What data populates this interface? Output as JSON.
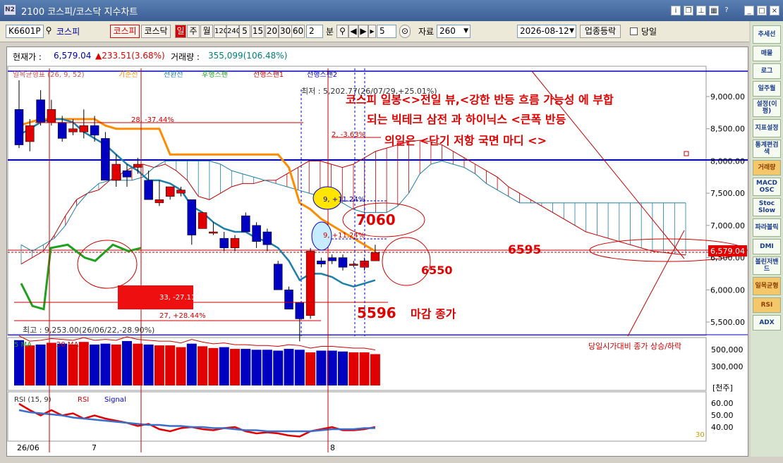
{
  "window": {
    "title": "2100 코스피/코스닥 지수차트",
    "logo": "N2"
  },
  "toolbar": {
    "code": "K6601P",
    "code_name": "코스피",
    "btn_kospi": "코스피",
    "btn_kosdaq": "코스닥",
    "periods": [
      "일",
      "주",
      "월",
      "120",
      "240",
      "5",
      "15",
      "20",
      "30",
      "60"
    ],
    "min_value": "2",
    "min_label": "분",
    "step_value": "5",
    "data_label": "자료",
    "data_value": "260",
    "date": "2026-08-12",
    "sector_btn": "업종등락",
    "today_label": "당일"
  },
  "info": {
    "price_label": "현재가 :",
    "price": "6,579.04",
    "change": "▲233.51(3.68%)",
    "volume_label": "거래량 :",
    "volume": "355,099(106.48%)"
  },
  "legend": {
    "ichimoku": "일목균형표 (26, 9, 52)",
    "items": [
      "기준선",
      "전환선",
      "후행스팬",
      "선행스팬1",
      "선행스팬2"
    ]
  },
  "annotations": {
    "line1": "코스피 일봉<>전일 뷰,<강한 반등 흐름  가능성 에 부합",
    "line2": "되는 빅테크 삼전 과 하이닉스 <큰폭 반등",
    "line3": "의일은 <단기 저항 국면 마디 <>",
    "high_label": "최저 : 5,202.77(26/07/29,+25.01%)",
    "low_label": "최고 : 9,253.00(26/06/22,-28.90%)",
    "m1": "28, -37.44%",
    "m2": "2, -3.63%",
    "m3": "9, +11.24%",
    "m4": "9, +11.24%",
    "m5": "33, -27.11%",
    "m6": "27, +28.44%",
    "v7060": "7060",
    "v6595": "6595",
    "v6550": "6550",
    "v5596": "5596",
    "closing": "마감 종가",
    "vol_note": "당일시가대비 종가 상승/하락"
  },
  "axis": {
    "price_ticks": [
      "9,000.00",
      "8,500.00",
      "8,000.00",
      "7,500.00",
      "7,000.00",
      "6,500.00",
      "6,000.00",
      "5,500.00"
    ],
    "current_tag": "6,579.04",
    "vol_ticks": [
      "500,000",
      "300,000"
    ],
    "vol_unit": "[천주]",
    "rsi_ticks": [
      "60.00",
      "50.00",
      "40.00"
    ],
    "rsi_level": "30",
    "x_labels": [
      "26/06",
      "7",
      "8"
    ]
  },
  "panels": {
    "vol_legend": [
      "5 MA",
      "20 MA"
    ],
    "rsi_legend": [
      "RSI (15, 9)",
      "RSI",
      "Signal"
    ]
  },
  "right_menu": [
    "추세선",
    "매물",
    "로그",
    "일주월",
    "설정(이평)",
    "지표설정",
    "통계편검색",
    "거래량",
    "MACD OSC",
    "Stoc Slow",
    "파라볼릭",
    "DMI",
    "볼린저밴드",
    "일목균형",
    "RSI",
    "ADX"
  ],
  "colors": {
    "up": "#e00000",
    "down": "#0000c0",
    "kijun": "#ff8c00",
    "tenkan": "#1e7fa8",
    "chikou": "#1fa01f",
    "span": "#c00000"
  },
  "chart_data": {
    "type": "candlestick",
    "candles": [
      [
        8800,
        9253,
        8200,
        8250
      ],
      [
        8300,
        8650,
        8150,
        8550
      ],
      [
        8950,
        9100,
        8550,
        8600
      ],
      [
        8600,
        8950,
        8550,
        8800
      ],
      [
        8600,
        8700,
        8300,
        8350
      ],
      [
        8450,
        8650,
        8400,
        8500
      ],
      [
        8450,
        8800,
        8350,
        8550
      ],
      [
        8550,
        8700,
        8300,
        8400
      ],
      [
        8350,
        8450,
        7800,
        7700
      ],
      [
        7700,
        8100,
        7600,
        7950
      ],
      [
        7850,
        7950,
        7600,
        7750
      ],
      [
        7900,
        8050,
        7800,
        7950
      ],
      [
        7700,
        7850,
        7400,
        7400
      ],
      [
        7350,
        7700,
        7300,
        7400
      ],
      [
        7450,
        7600,
        7400,
        7600
      ],
      [
        7500,
        7600,
        7450,
        7550
      ],
      [
        7400,
        7400,
        6700,
        6850
      ],
      [
        6950,
        7200,
        6950,
        7200
      ],
      [
        6900,
        7050,
        6850,
        6900
      ],
      [
        6800,
        6900,
        6600,
        6650
      ],
      [
        6650,
        6850,
        6600,
        6800
      ],
      [
        7150,
        7200,
        6900,
        6900
      ],
      [
        7000,
        7050,
        6650,
        6750
      ],
      [
        6900,
        6950,
        6600,
        6700
      ],
      [
        6400,
        6450,
        6000,
        6000
      ],
      [
        6000,
        6050,
        5700,
        5700
      ],
      [
        5800,
        5800,
        5200,
        5550
      ],
      [
        5600,
        6650,
        5550,
        6600
      ],
      [
        6450,
        6500,
        6350,
        6400
      ],
      [
        6500,
        6550,
        6400,
        6450
      ],
      [
        6500,
        6550,
        6300,
        6350
      ],
      [
        6400,
        6450,
        6350,
        6400
      ],
      [
        6350,
        6500,
        6300,
        6450
      ],
      [
        6450,
        6700,
        6450,
        6579
      ]
    ],
    "vol_ticks": [
      500000,
      300000
    ],
    "rsi_range": [
      30,
      70
    ]
  }
}
